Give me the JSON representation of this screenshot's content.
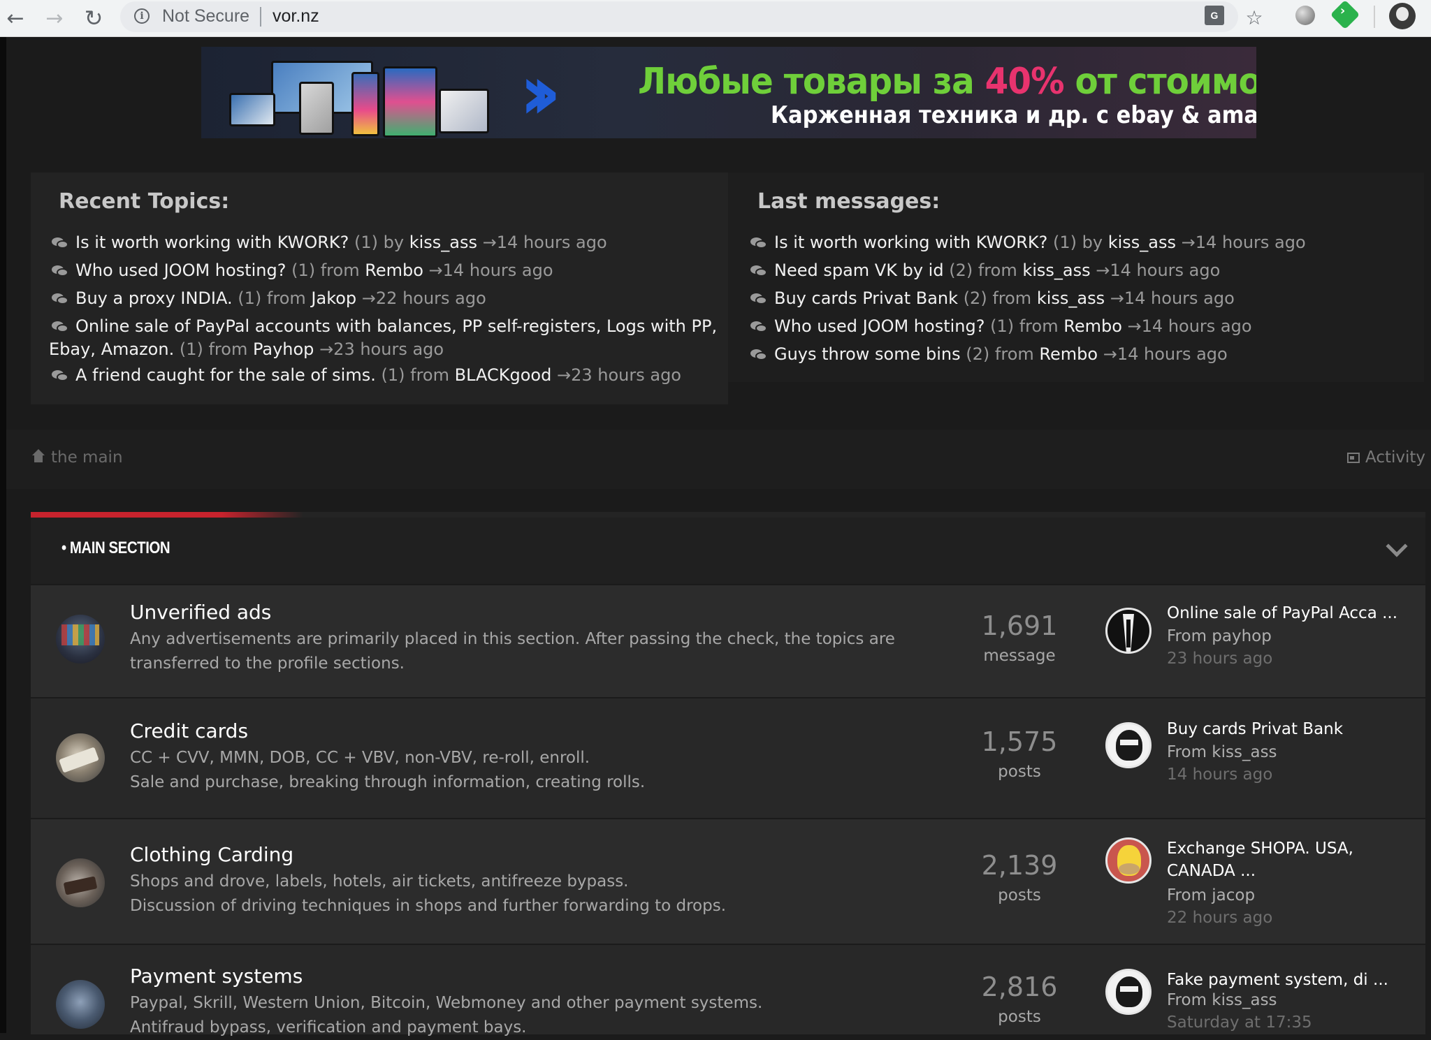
{
  "browser": {
    "security_label": "Not Secure",
    "url": "vor.nz"
  },
  "banner": {
    "line1_a": "Любые товары за ",
    "line1_pct": "40%",
    "line1_b": " от стоимости",
    "line2": "Карженная техника и др. с ebay & amazon"
  },
  "recent_topics": {
    "title": "Recent Topics:",
    "items": [
      {
        "title": "Is it worth working with KWORK?",
        "count": "(1)",
        "prep": "by",
        "user": "kiss_ass",
        "time": "→14 hours ago"
      },
      {
        "title": "Who used JOOM hosting?",
        "count": "(1)",
        "prep": "from",
        "user": "Rembo",
        "time": "→14 hours ago"
      },
      {
        "title": "Buy a proxy INDIA.",
        "count": "(1)",
        "prep": "from",
        "user": "Jakop",
        "time": "→22 hours ago"
      },
      {
        "title": "Online sale of PayPal accounts with balances, PP self-registers, Logs with PP, Ebay, Amazon.",
        "count": "(1)",
        "prep": "from",
        "user": "Payhop",
        "time": "→23 hours ago"
      },
      {
        "title": "A friend caught for the sale of sims.",
        "count": "(1)",
        "prep": "from",
        "user": "BLACKgood",
        "time": "→23 hours ago"
      }
    ]
  },
  "last_messages": {
    "title": "Last messages:",
    "items": [
      {
        "title": "Is it worth working with KWORK?",
        "count": "(1)",
        "prep": "by",
        "user": "kiss_ass",
        "time": "→14 hours ago"
      },
      {
        "title": "Need spam VK by id",
        "count": "(2)",
        "prep": "from",
        "user": "kiss_ass",
        "time": "→14 hours ago"
      },
      {
        "title": "Buy cards Privat Bank",
        "count": "(2)",
        "prep": "from",
        "user": "kiss_ass",
        "time": "→14 hours ago"
      },
      {
        "title": "Who used JOOM hosting?",
        "count": "(1)",
        "prep": "from",
        "user": "Rembo",
        "time": "→14 hours ago"
      },
      {
        "title": "Guys throw some bins",
        "count": "(2)",
        "prep": "from",
        "user": "Rembo",
        "time": "→14 hours ago"
      }
    ]
  },
  "breadcrumb": {
    "home": "the main",
    "activity": "Activity"
  },
  "section": {
    "title": "MAIN SECTION",
    "forums": [
      {
        "title": "Unverified ads",
        "desc": "Any advertisements are primarily placed in this section. After passing the check, the topics are transferred to the profile sections.",
        "count": "1,691",
        "count_label": "message",
        "last_title": "Online sale of PayPal Acca ...",
        "last_from": "From payhop",
        "last_time": "23 hours ago"
      },
      {
        "title": "Credit cards",
        "desc1": "CC + CVV, MMN, DOB, CC + VBV, non-VBV, re-roll, enroll.",
        "desc2": "Sale and purchase, breaking through information, creating rolls.",
        "count": "1,575",
        "count_label": "posts",
        "last_title": "Buy cards Privat Bank",
        "last_from": "From kiss_ass",
        "last_time": "14 hours ago"
      },
      {
        "title": "Clothing Carding",
        "desc1": "Shops and drove, labels, hotels, air tickets, antifreeze bypass.",
        "desc2": "Discussion of driving techniques in shops and further forwarding to drops.",
        "count": "2,139",
        "count_label": "posts",
        "last_title": "Exchange SHOPA. USA, CANADA ...",
        "last_from": "From jacop",
        "last_time": "22 hours ago"
      },
      {
        "title": "Payment systems",
        "desc1": "Paypal, Skrill, Western Union, Bitcoin, Webmoney and other payment systems.",
        "desc2": "Antifraud bypass, verification and payment bays.",
        "count": "2,816",
        "count_label": "posts",
        "last_title": "Fake payment system, di ...",
        "last_from": "From kiss_ass",
        "last_time": "Saturday at 17:35"
      }
    ]
  }
}
